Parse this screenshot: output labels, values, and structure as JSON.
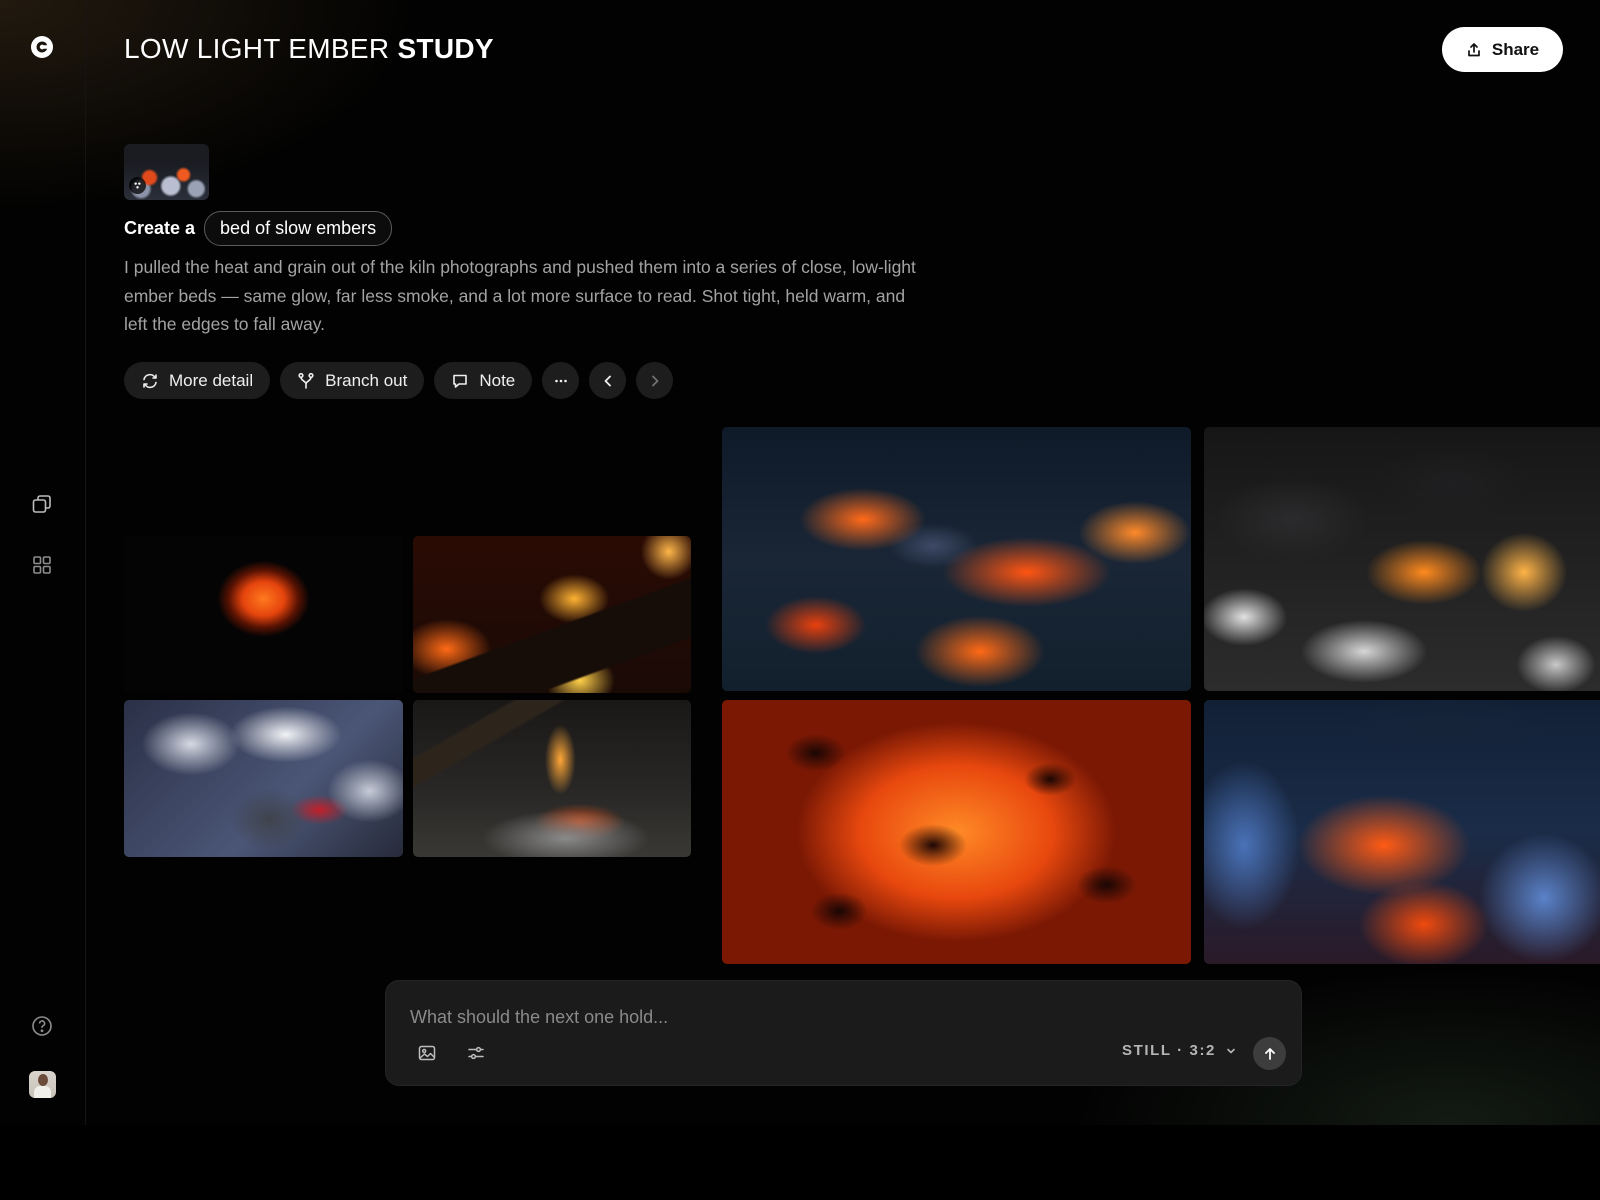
{
  "header": {
    "title_light": "LOW LIGHT EMBER",
    "title_bold": "STUDY",
    "share_label": "Share"
  },
  "prompt": {
    "create_label": "Create a",
    "subject_chip": "bed of slow embers",
    "description": "I pulled the heat and grain out of the kiln photographs and pushed them into a series of close, low-light ember beds — same glow, far less smoke, and a lot more surface to read. Shot tight, held warm, and left the edges to fall away."
  },
  "actions": {
    "more_detail": "More detail",
    "branch_out": "Branch out",
    "note": "Note"
  },
  "composer": {
    "placeholder": "What should the next one hold...",
    "mode": "STILL · 3:2"
  },
  "icons": {
    "logo": "logo-icon",
    "nav_stack": "stack-icon",
    "nav_grid": "grid-icon",
    "help": "help-icon",
    "share": "share-icon",
    "refresh": "refresh-icon",
    "branch": "branch-icon",
    "note": "comment-icon",
    "more": "more-icon",
    "prev": "chevron-left-icon",
    "next": "chevron-right-icon",
    "image": "image-icon",
    "settings": "sliders-icon",
    "send": "arrow-up-icon"
  },
  "colors": {
    "background": "#020202",
    "pill": "#1d1d1d",
    "composer": "#1b1b1b",
    "text_muted": "#a3a3a3"
  }
}
